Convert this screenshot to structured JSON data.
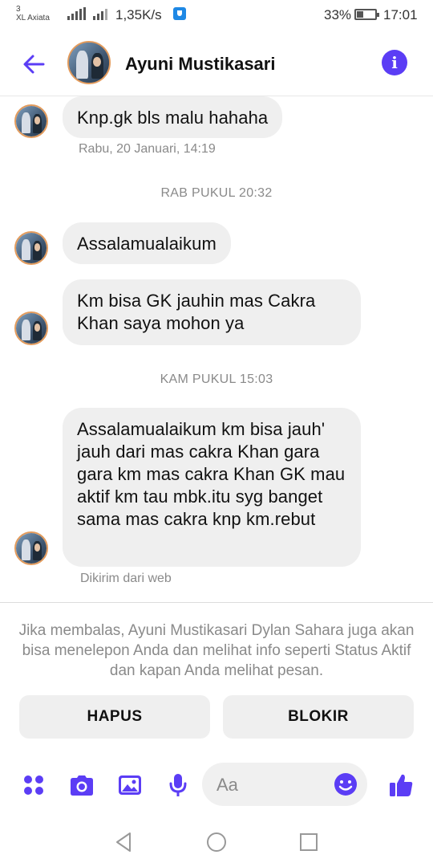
{
  "status_bar": {
    "sim_slot": "3",
    "carrier": "XL Axiata",
    "net_speed": "1,35K/s",
    "battery": "33%",
    "time": "17:01",
    "accent": "#1e88e5"
  },
  "header": {
    "contact_name": "Ayuni Mustikasari",
    "back_icon": "arrow-left-icon",
    "info_icon": "info-icon",
    "accent": "#5b3df5"
  },
  "messages": [
    {
      "text": "Knp.gk bls malu hahaha",
      "meta": "Rabu, 20 Januari, 14:19"
    },
    {
      "divider": "RAB PUKUL 20:32"
    },
    {
      "text": "Assalamualaikum"
    },
    {
      "text": "Km bisa GK jauhin mas Cakra Khan saya mohon ya"
    },
    {
      "divider": "KAM PUKUL 15:03"
    },
    {
      "text": "Assalamualaikum km bisa jauh' jauh dari mas cakra Khan gara gara km mas cakra Khan GK mau aktif km tau mbk.itu syg banget sama mas cakra  knp km.rebut",
      "meta": "Dikirim dari web"
    }
  ],
  "notice": "Jika membalas, Ayuni Mustikasari Dylan Sahara juga akan bisa menelepon Anda dan melihat info seperti Status Aktif dan kapan Anda melihat pesan.",
  "actions": {
    "delete_label": "HAPUS",
    "block_label": "BLOKIR"
  },
  "composer": {
    "placeholder": "Aa",
    "icons": [
      "apps-icon",
      "camera-icon",
      "image-icon",
      "microphone-icon",
      "emoji-icon",
      "thumbs-up-icon"
    ]
  },
  "navbar": {
    "icons": [
      "back-triangle-icon",
      "home-circle-icon",
      "recents-square-icon"
    ]
  }
}
